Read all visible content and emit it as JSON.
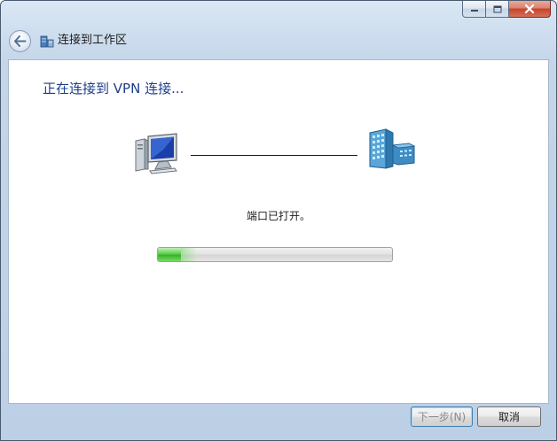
{
  "window": {
    "title": "连接到工作区",
    "controls": [
      "minimize",
      "maximize",
      "close"
    ]
  },
  "header": {
    "back_icon": "back-arrow-icon",
    "network_icon": "network-workplace-icon"
  },
  "main": {
    "heading": "正在连接到 VPN 连接...",
    "status": "端口已打开。",
    "progress_fraction": 0.1,
    "local_icon": "computer-icon",
    "remote_icon": "server-icon"
  },
  "footer": {
    "next_label": "下一步(N)",
    "cancel_label": "取消"
  },
  "colors": {
    "heading": "#1e3e8a",
    "progress": "#37b327",
    "frame": "#bccfe5"
  }
}
